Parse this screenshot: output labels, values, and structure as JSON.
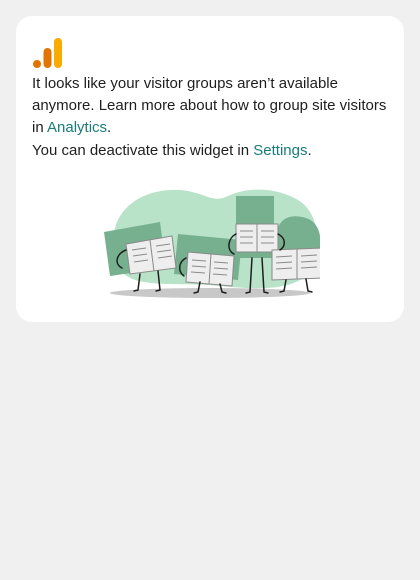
{
  "widget": {
    "logo": "google-analytics-logo",
    "message": {
      "line1": "It looks like your visitor groups aren’t available anymore. Learn more about how to group site visitors in ",
      "link_label": "Analytics",
      "after": "."
    },
    "deactivate": {
      "before": "You can deactivate this widget in ",
      "link_label": "Settings",
      "after": "."
    },
    "illustration": "people-reading-newspapers-illustration"
  },
  "colors": {
    "background": "#f0f0f0",
    "card": "#ffffff",
    "text": "#1e1e1e",
    "link": "#1a7b7b",
    "logo_orange": "#f9ab00",
    "logo_dark_orange": "#e37400",
    "illustration_green": "#b8e3c8",
    "sign_green": "#76b08f"
  }
}
